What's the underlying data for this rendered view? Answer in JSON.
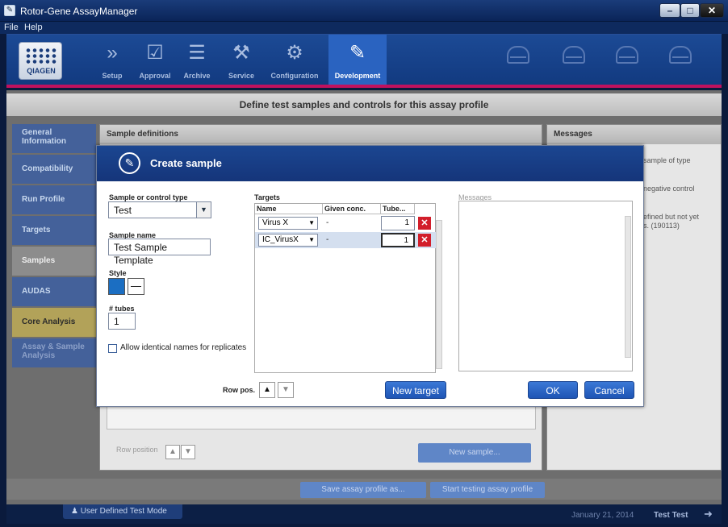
{
  "window": {
    "title": "Rotor-Gene AssayManager",
    "controls": {
      "minimize": "–",
      "maximize": "□",
      "close": "✕"
    }
  },
  "menu": [
    "File",
    "Help"
  ],
  "logo": "QIAGEN",
  "toolbar": {
    "items": [
      {
        "label": "Setup",
        "icon": "chevrons-icon",
        "glyph": "»"
      },
      {
        "label": "Approval",
        "icon": "approval-check-icon",
        "glyph": "☑"
      },
      {
        "label": "Archive",
        "icon": "archive-icon",
        "glyph": "☰"
      },
      {
        "label": "Service",
        "icon": "tools-icon",
        "glyph": "⚒"
      },
      {
        "label": "Configuration",
        "icon": "gears-icon",
        "glyph": "⚙"
      },
      {
        "label": "Development",
        "icon": "development-icon",
        "glyph": "✎"
      }
    ],
    "active": "Development"
  },
  "page_header": "Define test samples and controls for this assay profile",
  "sidebar": [
    {
      "label": "General Information",
      "state": "normal"
    },
    {
      "label": "Compatibility",
      "state": "normal"
    },
    {
      "label": "Run Profile",
      "state": "normal"
    },
    {
      "label": "Targets",
      "state": "normal"
    },
    {
      "label": "Samples",
      "state": "active"
    },
    {
      "label": "AUDAS",
      "state": "normal"
    },
    {
      "label": "Core Analysis",
      "state": "highlight"
    },
    {
      "label": "Assay & Sample Analysis",
      "state": "disabled"
    }
  ],
  "sample_panel": {
    "header": "Sample definitions",
    "row_position_label": "Row position",
    "new_sample_label": "New sample..."
  },
  "messages_panel": {
    "header": "Messages",
    "fragments": [
      "sample of type",
      "negative control",
      "efined but not yet",
      "s. (190113)"
    ]
  },
  "bottom": {
    "save_label": "Save assay profile as...",
    "test_label": "Start testing assay profile"
  },
  "status": {
    "mode": "User Defined Test Mode",
    "date": "January 21, 2014",
    "user": "Test Test"
  },
  "dialog": {
    "title": "Create sample",
    "sample_type_label": "Sample or control type",
    "sample_type_value": "Test",
    "sample_name_label": "Sample name",
    "sample_name_value": "Test Sample Template",
    "style_label": "Style",
    "style_color": "#1b6ec2",
    "tubes_label": "# tubes",
    "tubes_value": "1",
    "allow_identical_label": "Allow identical names for replicates",
    "allow_identical_checked": false,
    "targets_label": "Targets",
    "targets_columns": [
      "Name",
      "Given conc.",
      "Tube..."
    ],
    "targets_rows": [
      {
        "name": "Virus X",
        "conc": "-",
        "tube": "1",
        "selected": false
      },
      {
        "name": "IC_VirusX",
        "conc": "-",
        "tube": "1",
        "selected": true
      }
    ],
    "messages_label": "Messages",
    "row_pos_label": "Row pos.",
    "new_target_label": "New target",
    "ok_label": "OK",
    "cancel_label": "Cancel"
  }
}
